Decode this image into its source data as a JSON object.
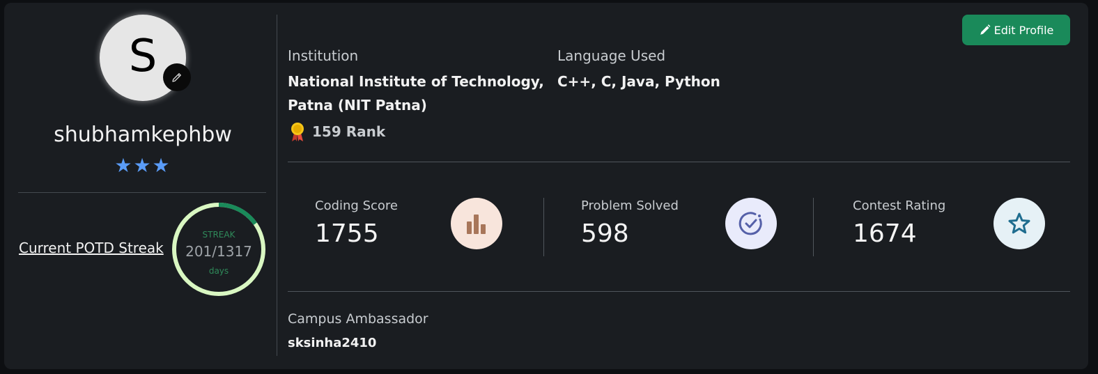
{
  "profile": {
    "avatar_letter": "S",
    "username": "shubhamkephbw",
    "stars": "★★★",
    "star_count": 3
  },
  "potd": {
    "link_label": "Current POTD Streak",
    "streak_label": "STREAK",
    "streak_value": "201/1317",
    "streak_current": 201,
    "streak_total": 1317,
    "unit": "days"
  },
  "actions": {
    "edit_profile_label": "Edit Profile"
  },
  "info": {
    "institution_label": "Institution",
    "institution_line1": "National Institute of Technology,",
    "institution_line2": "Patna (NIT Patna)",
    "rank_text": "159 Rank",
    "language_label": "Language Used",
    "language_value": "C++, C, Java, Python"
  },
  "stats": [
    {
      "label": "Coding Score",
      "value": "1755",
      "icon": "bar-chart-icon"
    },
    {
      "label": "Problem Solved",
      "value": "598",
      "icon": "check-circle-icon"
    },
    {
      "label": "Contest Rating",
      "value": "1674",
      "icon": "star-icon"
    }
  ],
  "campus_ambassador": {
    "label": "Campus Ambassador",
    "value": "sksinha2410"
  },
  "colors": {
    "background": "#1a1d21",
    "accent": "#1a8a5a",
    "star": "#5a9cf8",
    "streak_ring": "#d9f7c2",
    "streak_progress": "#1a8a5a"
  }
}
